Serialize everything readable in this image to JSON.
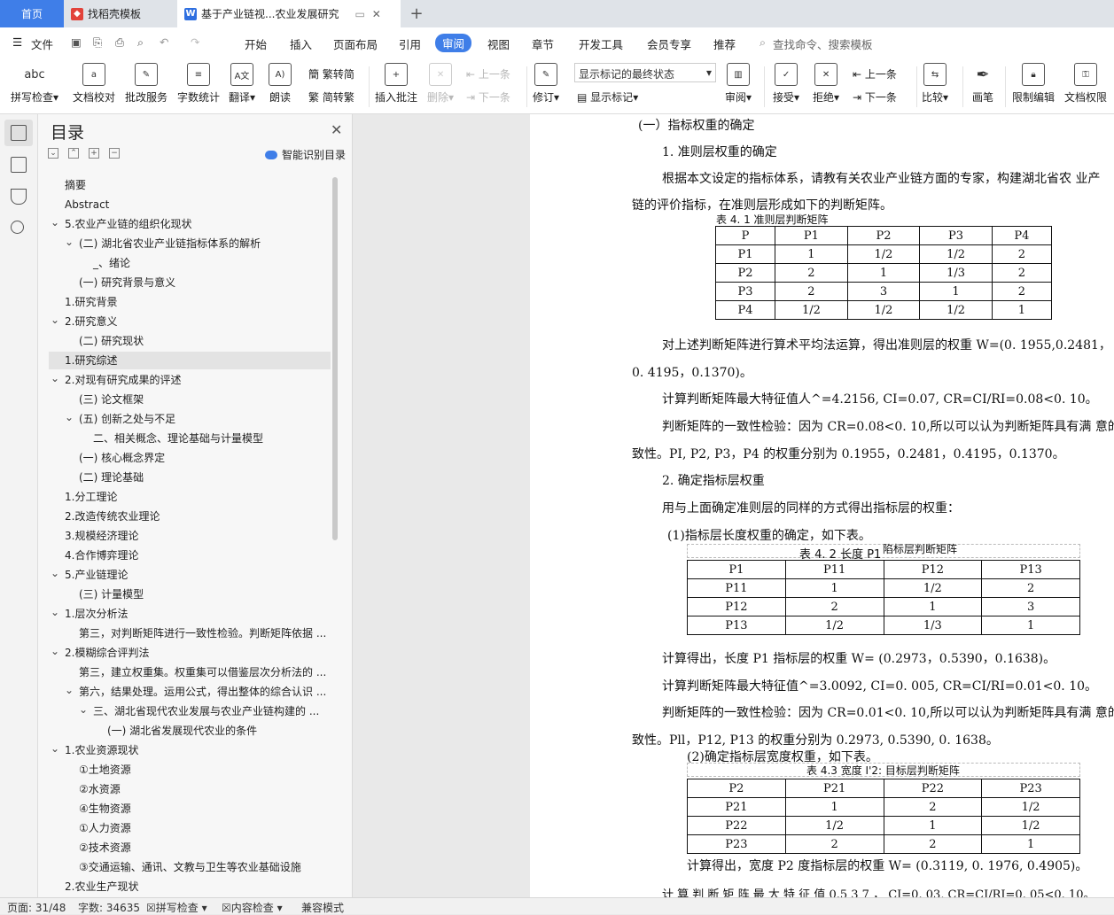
{
  "tabs": {
    "home": "首页",
    "template": "找稻壳模板",
    "document": "基于产业链视...农业发展研究"
  },
  "menu": [
    "文件",
    "开始",
    "插入",
    "页面布局",
    "引用",
    "审阅",
    "视图",
    "章节",
    "开发工具",
    "会员专享",
    "推荐"
  ],
  "menu_active": "审阅",
  "search_placeholder": "查找命令、搜索模板",
  "ribbon": {
    "spell": "拼写检查",
    "proof": "文档校对",
    "annotate": "批改服务",
    "wordcount": "字数统计",
    "translate": "翻译",
    "read": "朗读",
    "trad": "繁转简",
    "simp": "简转繁",
    "insert_comment": "插入批注",
    "delete": "删除",
    "prev_comment": "上一条",
    "next_comment": "下一条",
    "revise": "修订",
    "markup_state": "显示标记的最终状态",
    "show_markup": "显示标记",
    "review": "审阅",
    "accept": "接受",
    "reject": "拒绝",
    "prev": "上一条",
    "next": "下一条",
    "compare": "比较",
    "pen": "画笔",
    "restrict": "限制编辑",
    "permission": "文档权限"
  },
  "toc": {
    "title": "目录",
    "smart": "智能识别目录",
    "items": [
      {
        "text": "摘要",
        "level": 0,
        "arrow": false
      },
      {
        "text": "Abstract",
        "level": 0,
        "arrow": false
      },
      {
        "text": "5.农业产业链的组织化现状",
        "level": 0,
        "arrow": true
      },
      {
        "text": "(二)  湖北省农业产业链指标体系的解析",
        "level": 1,
        "arrow": true
      },
      {
        "text": "_、绪论",
        "level": 2,
        "arrow": false
      },
      {
        "text": "(一) 研究背景与意义",
        "level": 1,
        "arrow": false
      },
      {
        "text": "1.研究背景",
        "level": 0,
        "arrow": false
      },
      {
        "text": "2.研究意义",
        "level": 0,
        "arrow": true
      },
      {
        "text": "(二) 研究现状",
        "level": 1,
        "arrow": false
      },
      {
        "text": "1.研究综述",
        "level": 0,
        "arrow": false,
        "selected": true
      },
      {
        "text": "2.对现有研究成果的评述",
        "level": 0,
        "arrow": true
      },
      {
        "text": "(三) 论文框架",
        "level": 1,
        "arrow": false
      },
      {
        "text": "(五) 创新之处与不足",
        "level": 1,
        "arrow": true
      },
      {
        "text": "二、相关概念、理论基础与计量模型",
        "level": 2,
        "arrow": false
      },
      {
        "text": "(一) 核心概念界定",
        "level": 1,
        "arrow": false
      },
      {
        "text": "(二) 理论基础",
        "level": 1,
        "arrow": false
      },
      {
        "text": "1.分工理论",
        "level": 0,
        "arrow": false
      },
      {
        "text": "2.改造传统农业理论",
        "level": 0,
        "arrow": false
      },
      {
        "text": "3.规模经济理论",
        "level": 0,
        "arrow": false
      },
      {
        "text": "4.合作博弈理论",
        "level": 0,
        "arrow": false
      },
      {
        "text": "5.产业链理论",
        "level": 0,
        "arrow": true
      },
      {
        "text": "(三) 计量模型",
        "level": 1,
        "arrow": false
      },
      {
        "text": "1.层次分析法",
        "level": 0,
        "arrow": true
      },
      {
        "text": "第三，对判断矩阵进行一致性检验。判断矩阵依据 ...",
        "level": 1,
        "arrow": false
      },
      {
        "text": "2.模糊综合评判法",
        "level": 0,
        "arrow": true
      },
      {
        "text": "第三，建立权重集。权重集可以借鉴层次分析法的 ...",
        "level": 1,
        "arrow": false
      },
      {
        "text": "第六，结果处理。运用公式，得出整体的综合认识 ...",
        "level": 1,
        "arrow": true
      },
      {
        "text": "三、湖北省现代农业发展与农业产业链构建的 ...",
        "level": 2,
        "arrow": true
      },
      {
        "text": "(一) 湖北省发展现代农业的条件",
        "level": 3,
        "arrow": false
      },
      {
        "text": "1.农业资源现状",
        "level": 0,
        "arrow": true
      },
      {
        "text": "①土地资源",
        "level": 1,
        "arrow": false
      },
      {
        "text": "②水资源",
        "level": 1,
        "arrow": false
      },
      {
        "text": "④生物资源",
        "level": 1,
        "arrow": false
      },
      {
        "text": "①人力资源",
        "level": 1,
        "arrow": false
      },
      {
        "text": "②技术资源",
        "level": 1,
        "arrow": false
      },
      {
        "text": "③交通运输、通讯、文教与卫生等农业基础设施",
        "level": 1,
        "arrow": false
      },
      {
        "text": "2.农业生产现状",
        "level": 0,
        "arrow": false
      }
    ]
  },
  "doc": {
    "h1": "(一）指标权重的确定",
    "h2": "1.    准则层权重的确定",
    "p1a": "根据本文设定的指标体系，请教有关农业产业链方面的专家，构建湖北省农 业产",
    "p1b": "链的评价指标，在准则层形成如下的判断矩阵。",
    "t1_cap": "表 4. 1 准则层判断矩阵",
    "t1": [
      [
        "P",
        "P1",
        "P2",
        "P3",
        "P4"
      ],
      [
        "P1",
        "1",
        "1/2",
        "1/2",
        "2"
      ],
      [
        "P2",
        "2",
        "1",
        "1/3",
        "2"
      ],
      [
        "P3",
        "2",
        "3",
        "1",
        "2"
      ],
      [
        "P4",
        "1/2",
        "1/2",
        "1/2",
        "1"
      ]
    ],
    "p2a": "对上述判断矩阵进行算术平均法运算，得出准则层的权重 W=(0. 1955,0.2481，",
    "p2b": "0.    4195，0.1370)。",
    "p3": "计算判断矩阵最大特征值人^=4.2156, CI=0.07, CR=CI/RI=0.08<0. 10。",
    "p4a": "判断矩阵的一致性检验：因为 CR=0.08<0. 10,所以可以认为判断矩阵具有满 意的",
    "p4b": "致性。PI, P2, P3，P4 的权重分别为 0.1955，0.2481，0.4195，0.1370。",
    "h3": "2.    确定指标层权重",
    "p5": "用与上面确定准则层的同样的方式得出指标层的权重：",
    "p6": "(1)指标层长度权重的确定，如下表。",
    "t2_cap": "表 4. 2 长度 P1",
    "t2_cap2": "陷标层判断矩阵",
    "t2": [
      [
        "P1",
        "P11",
        "P12",
        "P13"
      ],
      [
        "P11",
        "1",
        "1/2",
        "2"
      ],
      [
        "P12",
        "2",
        "1",
        "3"
      ],
      [
        "P13",
        "1/2",
        "1/3",
        "1"
      ]
    ],
    "p7": "计算得出，长度 P1 指标层的权重 W= (0.2973，0.5390，0.1638)。",
    "p8": "计算判断矩阵最大特征值^=3.0092, CI=0. 005, CR=CI/RI=0.01<0. 10。",
    "p9a": "判断矩阵的一致性检验：因为 CR=0.01<0. 10,所以可以认为判断矩阵具有满 意的",
    "p9b": "致性。Pll，P12, P13 的权重分别为 0.2973, 0.5390, 0. 1638。",
    "p10": "(2)确定指标层宽度权重，如下表。",
    "t3_cap": "表 4.3 宽度 I'2: 目标层判断矩阵",
    "t3": [
      [
        "P2",
        "P21",
        "P22",
        "P23"
      ],
      [
        "P21",
        "1",
        "2",
        "1/2"
      ],
      [
        "P22",
        "1/2",
        "1",
        "1/2"
      ],
      [
        "P23",
        "2",
        "2",
        "1"
      ]
    ],
    "p11": "计算得出，宽度 P2 度指标层的权重 W= (0.3119, 0. 1976, 0.4905)。",
    "p12": "计 算 判 断 矩 阵 最 大 特 征 值 0.5 3 7 ， CI=0. 03, CR=CI/RI=0. 05<0. 10。"
  },
  "status": {
    "page": "页面: 31/48",
    "words": "字数: 34635",
    "spell": "拼写检查",
    "content": "内容检查",
    "compat": "兼容模式"
  }
}
